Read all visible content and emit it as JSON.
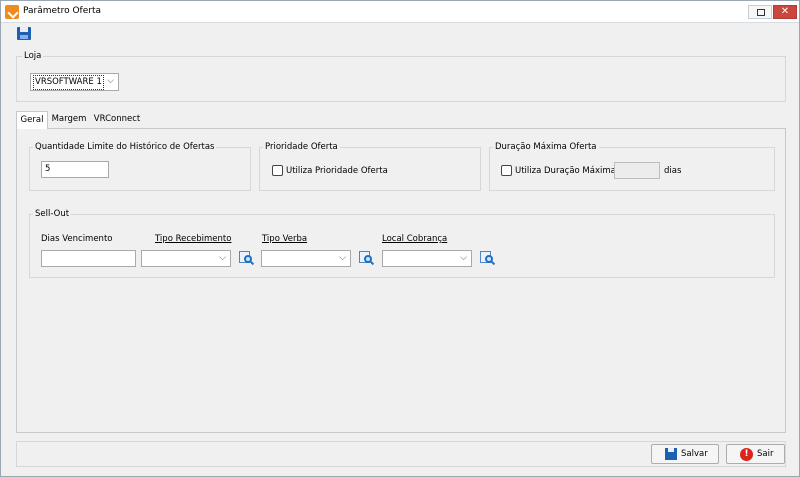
{
  "window": {
    "title": "Parâmetro Oferta",
    "close_glyph": "✕"
  },
  "toolbar": {
    "save_icon": "floppy-disk-icon"
  },
  "loja": {
    "label": "Loja",
    "selected": "VRSOFTWARE 1",
    "chevron": "⌵"
  },
  "tabs": [
    {
      "label": "Geral",
      "active": true
    },
    {
      "label": "Margem",
      "active": false
    },
    {
      "label": "VRConnect",
      "active": false
    }
  ],
  "qtd_limite": {
    "label": "Quantidade Limite do Histórico de Ofertas",
    "value": "5"
  },
  "prioridade": {
    "label": "Prioridade Oferta",
    "checkbox_label": "Utiliza Prioridade Oferta",
    "checked": false
  },
  "duracao": {
    "label": "Duração Máxima Oferta",
    "checkbox_label": "Utiliza Duração Máxima",
    "checked": false,
    "value": "",
    "unit": "dias"
  },
  "sell_out": {
    "label": "Sell-Out",
    "dias_vencimento_label": "Dias Vencimento",
    "dias_vencimento_value": "",
    "tipo_recebimento_label": "Tipo Recebimento",
    "tipo_verba_label": "Tipo Verba",
    "local_cobranca_label": "Local Cobrança",
    "chevron": "⌵"
  },
  "footer": {
    "salvar_label": "Salvar",
    "sair_label": "Sair",
    "sair_glyph": "!"
  },
  "colors": {
    "accent": "#1d5fb0",
    "close": "#c9473f",
    "exit": "#d9251c",
    "app_icon": "#f08a1c"
  }
}
